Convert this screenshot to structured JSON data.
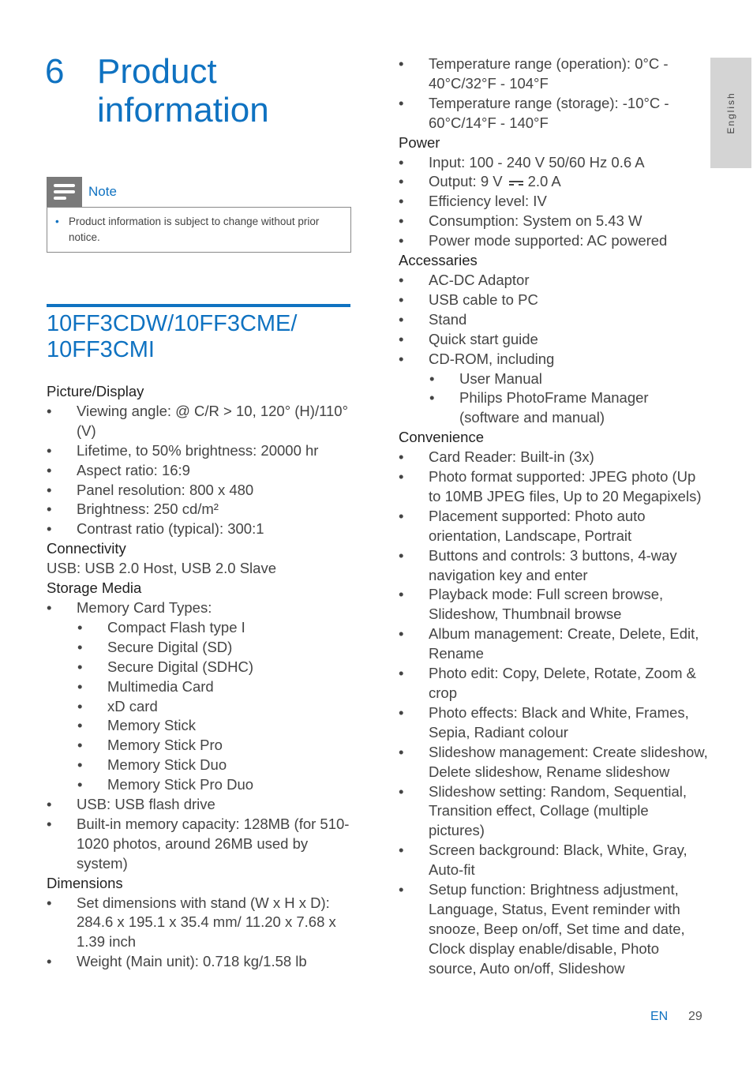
{
  "chapter": {
    "number": "6",
    "title": "Product information"
  },
  "note": {
    "label": "Note",
    "icon": "note-lines-icon",
    "text": "Product information is subject to change without prior notice."
  },
  "model": "10FF3CDW/10FF3CME/ 10FF3CMI",
  "left": {
    "picture": {
      "heading": "Picture/Display",
      "items": [
        "Viewing angle: @ C/R > 10, 120° (H)/110° (V)",
        "Lifetime, to 50% brightness: 20000 hr",
        "Aspect ratio: 16:9",
        "Panel resolution: 800 x 480",
        "Brightness: 250 cd/m²",
        "Contrast ratio (typical): 300:1"
      ]
    },
    "connectivity": {
      "heading": "Connectivity",
      "text": "USB: USB 2.0 Host, USB 2.0 Slave"
    },
    "storage": {
      "heading": "Storage Media",
      "card_types_label": "Memory Card Types:",
      "card_types": [
        "Compact Flash type I",
        "Secure Digital (SD)",
        "Secure Digital (SDHC)",
        "Multimedia Card",
        "xD card",
        "Memory Stick",
        "Memory Stick Pro",
        "Memory Stick Duo",
        "Memory Stick Pro Duo"
      ],
      "items": [
        "USB: USB flash drive",
        "Built-in memory capacity: 128MB (for 510-1020 photos, around 26MB used by system)"
      ]
    },
    "dimensions": {
      "heading": "Dimensions",
      "items": [
        "Set dimensions with stand (W x H x D): 284.6 x 195.1 x 35.4 mm/ 11.20 x 7.68 x 1.39 inch",
        "Weight (Main unit): 0.718 kg/1.58 lb"
      ]
    }
  },
  "right": {
    "temperature": [
      "Temperature range (operation): 0°C - 40°C/32°F - 104°F",
      "Temperature range (storage): -10°C - 60°C/14°F - 140°F"
    ],
    "power": {
      "heading": "Power",
      "input": "Input: 100 - 240 V 50/60 Hz 0.6 A",
      "output_prefix": "Output: 9 V",
      "output_suffix": "2.0 A",
      "output_symbol": "dc-current-icon",
      "items": [
        "Efficiency level: IV",
        "Consumption: System on 5.43 W",
        "Power mode supported: AC powered"
      ]
    },
    "accessories": {
      "heading": "Accessaries",
      "items": [
        "AC-DC Adaptor",
        "USB cable to PC",
        "Stand",
        "Quick start guide",
        "CD-ROM, including"
      ],
      "cdrom_items": [
        "User Manual",
        "Philips PhotoFrame Manager (software and manual)"
      ]
    },
    "convenience": {
      "heading": "Convenience",
      "items": [
        "Card Reader: Built-in (3x)",
        "Photo format supported: JPEG photo (Up to 10MB JPEG files, Up to 20 Megapixels)",
        "Placement supported: Photo auto orientation, Landscape, Portrait",
        "Buttons and controls: 3 buttons, 4-way navigation key and enter",
        "Playback mode: Full screen browse, Slideshow, Thumbnail browse",
        "Album management: Create, Delete, Edit, Rename",
        "Photo edit: Copy, Delete, Rotate, Zoom & crop",
        "Photo effects: Black and White, Frames, Sepia, Radiant colour",
        "Slideshow management: Create slideshow, Delete slideshow, Rename slideshow",
        "Slideshow setting: Random, Sequential, Transition effect, Collage (multiple pictures)",
        "Screen background: Black, White, Gray, Auto-fit",
        "Setup function: Brightness adjustment, Language, Status, Event reminder with snooze, Beep on/off, Set time and date, Clock display enable/disable, Photo source, Auto on/off, Slideshow"
      ]
    }
  },
  "side_tab": {
    "label": "English"
  },
  "footer": {
    "lang": "EN",
    "page": "29"
  },
  "colors": {
    "accent": "#0f72c1",
    "text": "#444444",
    "tab_bg": "#d4d4d4",
    "note_icon_bg": "#7a7a7a"
  },
  "bullet": "•"
}
